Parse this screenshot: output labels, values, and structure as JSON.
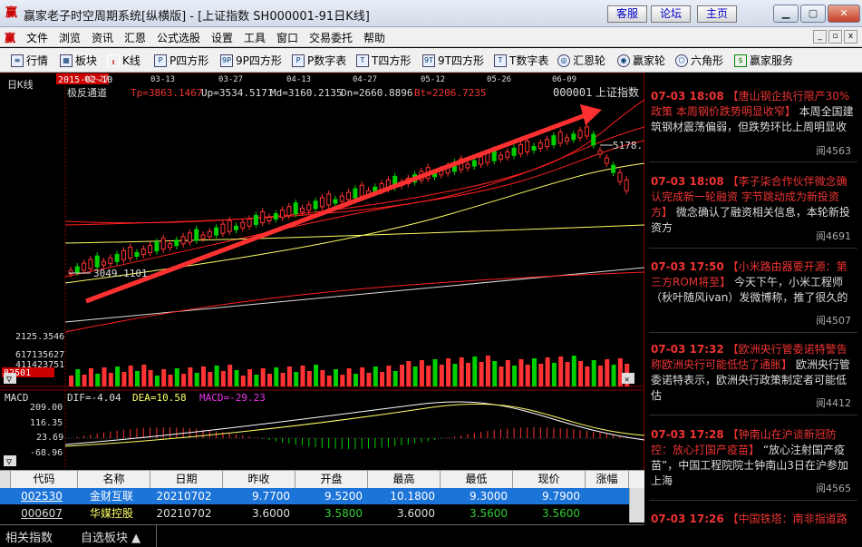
{
  "window": {
    "title": "赢家老子时空周期系统[纵横版] - [上证指数  SH000001-91日K线]",
    "top_links": [
      "客服",
      "论坛",
      "主页"
    ]
  },
  "menu": [
    "文件",
    "浏览",
    "资讯",
    "汇恩",
    "公式选股",
    "设置",
    "工具",
    "窗口",
    "交易委托",
    "帮助"
  ],
  "toolbar": [
    {
      "icon": "list-icon",
      "label": "行情"
    },
    {
      "icon": "blocks-icon",
      "label": "板块"
    },
    {
      "icon": "candlestick-icon",
      "label": "K线"
    },
    {
      "icon": "p-square-icon",
      "label": "P四方形"
    },
    {
      "icon": "9p-square-icon",
      "label": "9P四方形"
    },
    {
      "icon": "p-number-table-icon",
      "label": "P数字表"
    },
    {
      "icon": "t-square-icon",
      "label": "T四方形"
    },
    {
      "icon": "9t-square-icon",
      "label": "9T四方形"
    },
    {
      "icon": "t-number-table-icon",
      "label": "T数字表"
    },
    {
      "icon": "wheel-icon",
      "label": "汇恩轮"
    },
    {
      "icon": "winner-wheel-icon",
      "label": "赢家轮"
    },
    {
      "icon": "hexagon-icon",
      "label": "六角形"
    },
    {
      "icon": "dollar-icon",
      "label": "赢家服务"
    }
  ],
  "chart": {
    "period_label": "日K线",
    "start_date": "2015-02-10",
    "dates": [
      "02-27",
      "03-13",
      "03-27",
      "04-13",
      "04-27",
      "05-12",
      "05-26",
      "06-09"
    ],
    "indicator_name": "极反通道",
    "tp": "Tp=3863.1467",
    "up": "Up=3534.5171",
    "md": "Md=3160.2135",
    "dn": "Dn=2660.8896",
    "bt": "Bt=2206.7235",
    "stock_code": "000001",
    "stock_name": "上证指数",
    "price_high_label": "5178.",
    "price_low_label": "3049.1101",
    "price_axis_low": "2125.3546",
    "volume_labels": [
      "617135627",
      "411423751",
      "82501"
    ],
    "macd_name": "MACD",
    "dif": "DIF=-4.04",
    "dea": "DEA=10.58",
    "macd": "MACD=-29.23",
    "macd_axis": [
      "209.00",
      "116.35",
      "23.69",
      "-68.96"
    ],
    "colors": {
      "up": "#ff3333",
      "down": "#00d000",
      "channel": "#ffff66",
      "bound": "#ff2020",
      "arrow": "#ff3030"
    }
  },
  "news": [
    {
      "time": "07-03 18:08",
      "title": "【唐山钢企执行限产30%政策 本周钢价跌势明显收窄】",
      "body": "本周全国建筑钢材震荡偏弱，但跌势环比上周明显收",
      "reads": "阅4563"
    },
    {
      "time": "07-03 18:08",
      "title": "【李子柒合作伙伴微念确认完成新一轮融资 字节跳动成为新投资方】",
      "body": "微念确认了融资相关信息，本轮新投资方",
      "reads": "阅4691"
    },
    {
      "time": "07-03 17:50",
      "title": "【小米路由器要开源：第三方ROM将至】",
      "body": "今天下午，小米工程师（秋叶随风ivan）发微博称，推了很久的",
      "reads": "阅4507"
    },
    {
      "time": "07-03 17:32",
      "title": "【欧洲央行管委诺特警告称欧洲央行可能低估了通胀】",
      "body": "欧洲央行管委诺特表示，欧洲央行政策制定者可能低估",
      "reads": "阅4412"
    },
    {
      "time": "07-03 17:28",
      "title": "【钟南山在沪谈新冠防控：放心打国产疫苗】",
      "body": "“放心注射国产疫苗”，中国工程院院士钟南山3日在沪参加上海",
      "reads": "阅4565"
    },
    {
      "time": "07-03 17:26",
      "title": "【中国铁塔：南非指道路",
      "body": "",
      "reads": ""
    }
  ],
  "table": {
    "headers": [
      "代码",
      "名称",
      "日期",
      "昨收",
      "开盘",
      "最高",
      "最低",
      "现价",
      "涨幅"
    ],
    "rows": [
      {
        "code": "002530",
        "name": "金财互联",
        "date": "20210702",
        "prev": "9.7700",
        "open": "9.5200",
        "high": "10.1800",
        "low": "9.3000",
        "now": "9.7900"
      },
      {
        "code": "000607",
        "name": "华媒控股",
        "date": "20210702",
        "prev": "3.6000",
        "open": "3.5800",
        "high": "3.6000",
        "low": "3.5600",
        "now": "3.5600"
      }
    ]
  },
  "bottom_tabs": [
    "相关指数",
    "自选板块 ▲"
  ]
}
